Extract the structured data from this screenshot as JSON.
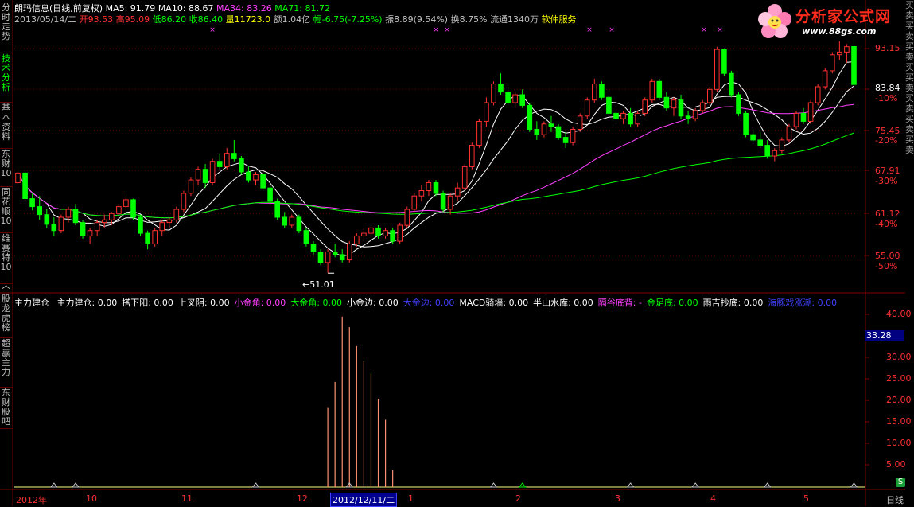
{
  "left_tabs": [
    {
      "label": "分时走势",
      "active": false
    },
    {
      "label": "技术分析",
      "active": true
    },
    {
      "label": "基本资料",
      "active": false
    },
    {
      "label": "东财10",
      "active": false
    },
    {
      "label": "同花顺10",
      "active": false
    },
    {
      "label": "维赛特10",
      "active": false
    },
    {
      "label": "个股龙虎榜",
      "active": false
    },
    {
      "label": "超赢主力",
      "active": false
    },
    {
      "label": "东财股吧",
      "active": false
    }
  ],
  "header": {
    "stock": "朗玛信息(日线,前复权)",
    "ma5": "MA5: 91.79",
    "ma10": "MA10: 88.67",
    "ma34": "MA34: 83.26",
    "ma71": "MA71: 81.72",
    "date": "2013/05/14/二",
    "open": "开93.53",
    "high": "高95.09",
    "low": "低86.20",
    "close": "收86.40",
    "volume": "量11723.0",
    "amount": "额1.04亿",
    "change": "幅-6.75(-7.25%)",
    "amplitude": "振8.89(9.54%)",
    "turnover": "换8.75%",
    "float": "流通1340万",
    "service": "软件服务"
  },
  "logo": {
    "brand": "分析家公式网",
    "url": "www.88gs.com"
  },
  "price_axis": [
    {
      "label": "93.15",
      "highlight": false
    },
    {
      "label": "83.84",
      "highlight": true
    },
    {
      "label": "-10%",
      "highlight": false
    },
    {
      "label": "75.45",
      "highlight": false
    },
    {
      "label": "-20%",
      "highlight": false
    },
    {
      "label": "67.91",
      "highlight": false
    },
    {
      "label": "-30%",
      "highlight": false
    },
    {
      "label": "61.12",
      "highlight": false
    },
    {
      "label": "-40%",
      "highlight": false
    },
    {
      "label": "55.00",
      "highlight": false
    },
    {
      "label": "-50%",
      "highlight": false
    }
  ],
  "low_marker": "←51.01",
  "indicator": {
    "name": "主力建仓",
    "items": [
      {
        "text": "主力建仓: 0.00",
        "color": "#ffffff"
      },
      {
        "text": "搭下阳: 0.00",
        "color": "#ffffff"
      },
      {
        "text": "上叉阴: 0.00",
        "color": "#ffffff"
      },
      {
        "text": "小金角: 0.00",
        "color": "#ff40ff"
      },
      {
        "text": "大金角: 0.00",
        "color": "#00ff00"
      },
      {
        "text": "小金边: 0.00",
        "color": "#ffffff"
      },
      {
        "text": "大金边: 0.00",
        "color": "#4040ff"
      },
      {
        "text": "MACD骑墙: 0.00",
        "color": "#ffffff"
      },
      {
        "text": "半山水库: 0.00",
        "color": "#ffffff"
      },
      {
        "text": "隔谷底背: -",
        "color": "#ff40ff"
      },
      {
        "text": "金足底: 0.00",
        "color": "#00ff00"
      },
      {
        "text": "雨吉抄底: 0.00",
        "color": "#ffffff"
      },
      {
        "text": "海豚戏涨潮: 0.00",
        "color": "#4040ff"
      }
    ],
    "axis": [
      "40.00",
      "30.00",
      "25.00",
      "20.00",
      "15.00",
      "10.00",
      "5.00"
    ],
    "current_value": "33.28"
  },
  "time_axis": [
    "2012年",
    "10",
    "11",
    "12",
    "1",
    "2",
    "3",
    "4",
    "5"
  ],
  "current_date": "2012/12/11/二",
  "period": "日线",
  "right_tabs": "买卖买卖买卖买买卖买卖买卖买卖",
  "colors": {
    "up": "#ff3030",
    "down": "#00ff00",
    "ma5": "#ffffff",
    "ma10": "#ffffff",
    "ma34": "#ff40ff",
    "ma71": "#00ff00",
    "grid": "#800000"
  },
  "chart_data": {
    "type": "candlestick",
    "price_range": [
      51.01,
      95.09
    ],
    "ohlc": [
      [
        68.0,
        71.2,
        67.0,
        69.8
      ],
      [
        69.8,
        70.0,
        64.5,
        65.0
      ],
      [
        65.0,
        66.0,
        62.8,
        63.5
      ],
      [
        63.5,
        65.5,
        61.0,
        62.0
      ],
      [
        62.0,
        63.0,
        59.5,
        60.2
      ],
      [
        60.2,
        61.5,
        58.0,
        59.0
      ],
      [
        59.0,
        62.0,
        58.5,
        61.5
      ],
      [
        61.5,
        63.5,
        60.5,
        63.0
      ],
      [
        63.0,
        64.0,
        60.0,
        60.5
      ],
      [
        60.5,
        61.0,
        57.5,
        58.0
      ],
      [
        58.0,
        59.5,
        56.5,
        59.0
      ],
      [
        59.0,
        61.0,
        58.0,
        60.5
      ],
      [
        60.5,
        62.0,
        59.5,
        61.0
      ],
      [
        61.0,
        62.5,
        60.0,
        62.2
      ],
      [
        62.2,
        64.0,
        61.5,
        63.5
      ],
      [
        63.5,
        65.5,
        62.5,
        64.8
      ],
      [
        64.8,
        65.0,
        61.0,
        61.5
      ],
      [
        61.5,
        62.0,
        58.0,
        58.5
      ],
      [
        58.5,
        59.0,
        55.5,
        56.5
      ],
      [
        56.5,
        59.5,
        56.0,
        59.0
      ],
      [
        59.0,
        61.0,
        58.0,
        60.5
      ],
      [
        60.5,
        61.5,
        59.5,
        61.0
      ],
      [
        61.0,
        63.5,
        60.5,
        63.0
      ],
      [
        63.0,
        66.5,
        62.5,
        66.0
      ],
      [
        66.0,
        69.0,
        65.5,
        68.5
      ],
      [
        68.5,
        71.0,
        67.5,
        70.5
      ],
      [
        70.5,
        71.5,
        67.0,
        68.0
      ],
      [
        68.0,
        72.5,
        67.5,
        72.0
      ],
      [
        72.0,
        73.5,
        70.5,
        71.0
      ],
      [
        71.0,
        74.5,
        70.5,
        73.5
      ],
      [
        73.5,
        76.0,
        72.0,
        72.5
      ],
      [
        72.5,
        73.0,
        69.5,
        70.0
      ],
      [
        70.0,
        71.0,
        68.0,
        68.5
      ],
      [
        68.5,
        70.0,
        67.5,
        69.5
      ],
      [
        69.5,
        70.0,
        66.5,
        67.0
      ],
      [
        67.0,
        67.5,
        64.0,
        64.5
      ],
      [
        64.5,
        65.0,
        61.0,
        61.5
      ],
      [
        61.5,
        62.5,
        59.5,
        60.0
      ],
      [
        60.0,
        62.0,
        59.5,
        61.5
      ],
      [
        61.5,
        62.0,
        58.5,
        59.0
      ],
      [
        59.0,
        59.5,
        56.0,
        56.5
      ],
      [
        56.5,
        57.0,
        54.5,
        55.0
      ],
      [
        55.0,
        55.5,
        52.5,
        53.0
      ],
      [
        53.0,
        55.5,
        51.01,
        55.0
      ],
      [
        55.0,
        56.5,
        54.0,
        54.5
      ],
      [
        54.5,
        55.5,
        53.0,
        53.5
      ],
      [
        53.5,
        57.0,
        53.0,
        56.5
      ],
      [
        56.5,
        58.5,
        56.0,
        58.0
      ],
      [
        58.0,
        59.5,
        57.0,
        58.5
      ],
      [
        58.5,
        60.0,
        58.0,
        59.5
      ],
      [
        59.5,
        60.0,
        57.5,
        58.0
      ],
      [
        58.0,
        59.5,
        57.5,
        59.0
      ],
      [
        59.0,
        59.5,
        56.5,
        57.0
      ],
      [
        57.0,
        60.5,
        56.5,
        60.0
      ],
      [
        60.0,
        63.5,
        59.5,
        63.0
      ],
      [
        63.0,
        66.0,
        62.5,
        65.5
      ],
      [
        65.5,
        67.5,
        64.5,
        66.5
      ],
      [
        66.5,
        68.5,
        65.5,
        68.0
      ],
      [
        68.0,
        68.5,
        65.5,
        66.0
      ],
      [
        66.0,
        66.5,
        62.5,
        63.0
      ],
      [
        63.0,
        66.0,
        62.0,
        65.5
      ],
      [
        65.5,
        68.0,
        64.5,
        67.0
      ],
      [
        67.0,
        71.5,
        66.5,
        71.0
      ],
      [
        71.0,
        75.5,
        70.5,
        75.0
      ],
      [
        75.0,
        80.0,
        74.5,
        79.5
      ],
      [
        79.5,
        84.0,
        78.5,
        83.0
      ],
      [
        83.0,
        87.0,
        82.5,
        86.5
      ],
      [
        86.5,
        88.5,
        84.5,
        85.0
      ],
      [
        85.0,
        86.0,
        82.5,
        83.0
      ],
      [
        83.0,
        85.0,
        82.0,
        84.5
      ],
      [
        84.5,
        85.5,
        82.0,
        82.5
      ],
      [
        82.5,
        83.0,
        77.5,
        78.0
      ],
      [
        78.0,
        79.5,
        76.0,
        77.0
      ],
      [
        77.0,
        79.5,
        76.5,
        79.0
      ],
      [
        79.0,
        80.5,
        77.5,
        78.5
      ],
      [
        78.5,
        79.0,
        76.0,
        76.5
      ],
      [
        76.5,
        77.5,
        74.5,
        75.5
      ],
      [
        75.5,
        78.5,
        75.0,
        78.0
      ],
      [
        78.0,
        81.0,
        77.5,
        80.5
      ],
      [
        80.5,
        84.0,
        80.0,
        83.5
      ],
      [
        83.5,
        87.5,
        83.0,
        86.5
      ],
      [
        86.5,
        87.0,
        83.5,
        84.0
      ],
      [
        84.0,
        84.5,
        80.5,
        81.0
      ],
      [
        81.0,
        82.0,
        79.5,
        80.0
      ],
      [
        80.0,
        81.5,
        79.0,
        81.0
      ],
      [
        81.0,
        82.0,
        78.5,
        79.0
      ],
      [
        79.0,
        81.5,
        78.5,
        81.0
      ],
      [
        81.0,
        84.0,
        80.5,
        83.5
      ],
      [
        83.5,
        87.5,
        83.0,
        87.0
      ],
      [
        87.0,
        87.5,
        83.5,
        84.0
      ],
      [
        84.0,
        85.0,
        81.5,
        82.0
      ],
      [
        82.0,
        84.0,
        80.5,
        83.5
      ],
      [
        83.5,
        84.5,
        80.0,
        80.5
      ],
      [
        80.5,
        81.5,
        79.0,
        80.0
      ],
      [
        80.0,
        82.0,
        79.5,
        81.5
      ],
      [
        81.5,
        83.5,
        81.0,
        83.0
      ],
      [
        83.0,
        86.0,
        82.5,
        85.5
      ],
      [
        85.5,
        93.5,
        85.0,
        93.0
      ],
      [
        93.0,
        93.2,
        88.0,
        88.5
      ],
      [
        88.5,
        89.0,
        84.0,
        84.5
      ],
      [
        84.5,
        85.0,
        80.5,
        81.0
      ],
      [
        81.0,
        81.5,
        76.5,
        77.0
      ],
      [
        77.0,
        78.0,
        75.5,
        76.0
      ],
      [
        76.0,
        77.5,
        74.5,
        75.0
      ],
      [
        75.0,
        76.0,
        72.5,
        73.0
      ],
      [
        73.0,
        74.5,
        72.0,
        74.0
      ],
      [
        74.0,
        76.5,
        73.5,
        76.0
      ],
      [
        76.0,
        79.0,
        75.5,
        78.5
      ],
      [
        78.5,
        81.5,
        78.0,
        81.0
      ],
      [
        81.0,
        82.0,
        79.0,
        79.5
      ],
      [
        79.5,
        83.5,
        79.0,
        83.0
      ],
      [
        83.0,
        86.5,
        82.5,
        86.0
      ],
      [
        86.0,
        89.5,
        85.5,
        89.0
      ],
      [
        89.0,
        92.5,
        88.5,
        92.0
      ],
      [
        92.0,
        94.5,
        91.0,
        92.5
      ],
      [
        92.5,
        94.0,
        90.5,
        93.5
      ],
      [
        93.53,
        95.09,
        86.2,
        86.4
      ]
    ],
    "indicator_range": [
      0,
      42
    ],
    "indicator_bars": [
      {
        "index": 43,
        "value": 19
      },
      {
        "index": 44,
        "value": 25
      },
      {
        "index": 45,
        "value": 40.5
      },
      {
        "index": 46,
        "value": 38
      },
      {
        "index": 47,
        "value": 33.5
      },
      {
        "index": 48,
        "value": 30
      },
      {
        "index": 49,
        "value": 27
      },
      {
        "index": 50,
        "value": 21
      },
      {
        "index": 51,
        "value": 16
      },
      {
        "index": 52,
        "value": 4
      }
    ],
    "signal_markers": [
      5,
      8,
      33,
      46,
      66,
      70,
      85,
      94,
      104,
      116
    ]
  }
}
